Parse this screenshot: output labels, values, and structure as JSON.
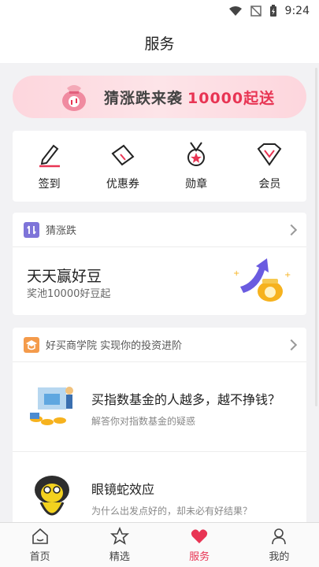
{
  "status": {
    "time": "9:24"
  },
  "header": {
    "title": "服务"
  },
  "banner": {
    "text": "猜涨跌来袭",
    "accent": "10000起送"
  },
  "quick": [
    {
      "label": "签到",
      "icon": "pencil-icon"
    },
    {
      "label": "优惠券",
      "icon": "ticket-icon"
    },
    {
      "label": "勋章",
      "icon": "medal-icon"
    },
    {
      "label": "会员",
      "icon": "diamond-icon"
    }
  ],
  "guess": {
    "section": "猜涨跌",
    "title": "天天赢好豆",
    "subtitle": "奖池10000好豆起"
  },
  "academy": {
    "section": "好买商学院 实现你的投资进阶",
    "articles": [
      {
        "title": "买指数基金的人越多，越不挣钱？",
        "desc": "解答你对指数基金的疑惑"
      },
      {
        "title": "眼镜蛇效应",
        "desc": "为什么出发点好的，却未必有好结果？"
      }
    ]
  },
  "tabs": [
    {
      "label": "首页",
      "icon": "home-icon"
    },
    {
      "label": "精选",
      "icon": "star-icon"
    },
    {
      "label": "服务",
      "icon": "heart-icon",
      "active": true
    },
    {
      "label": "我的",
      "icon": "user-icon"
    }
  ],
  "colors": {
    "accent": "#e83554",
    "banner": "#fdd6dd"
  }
}
